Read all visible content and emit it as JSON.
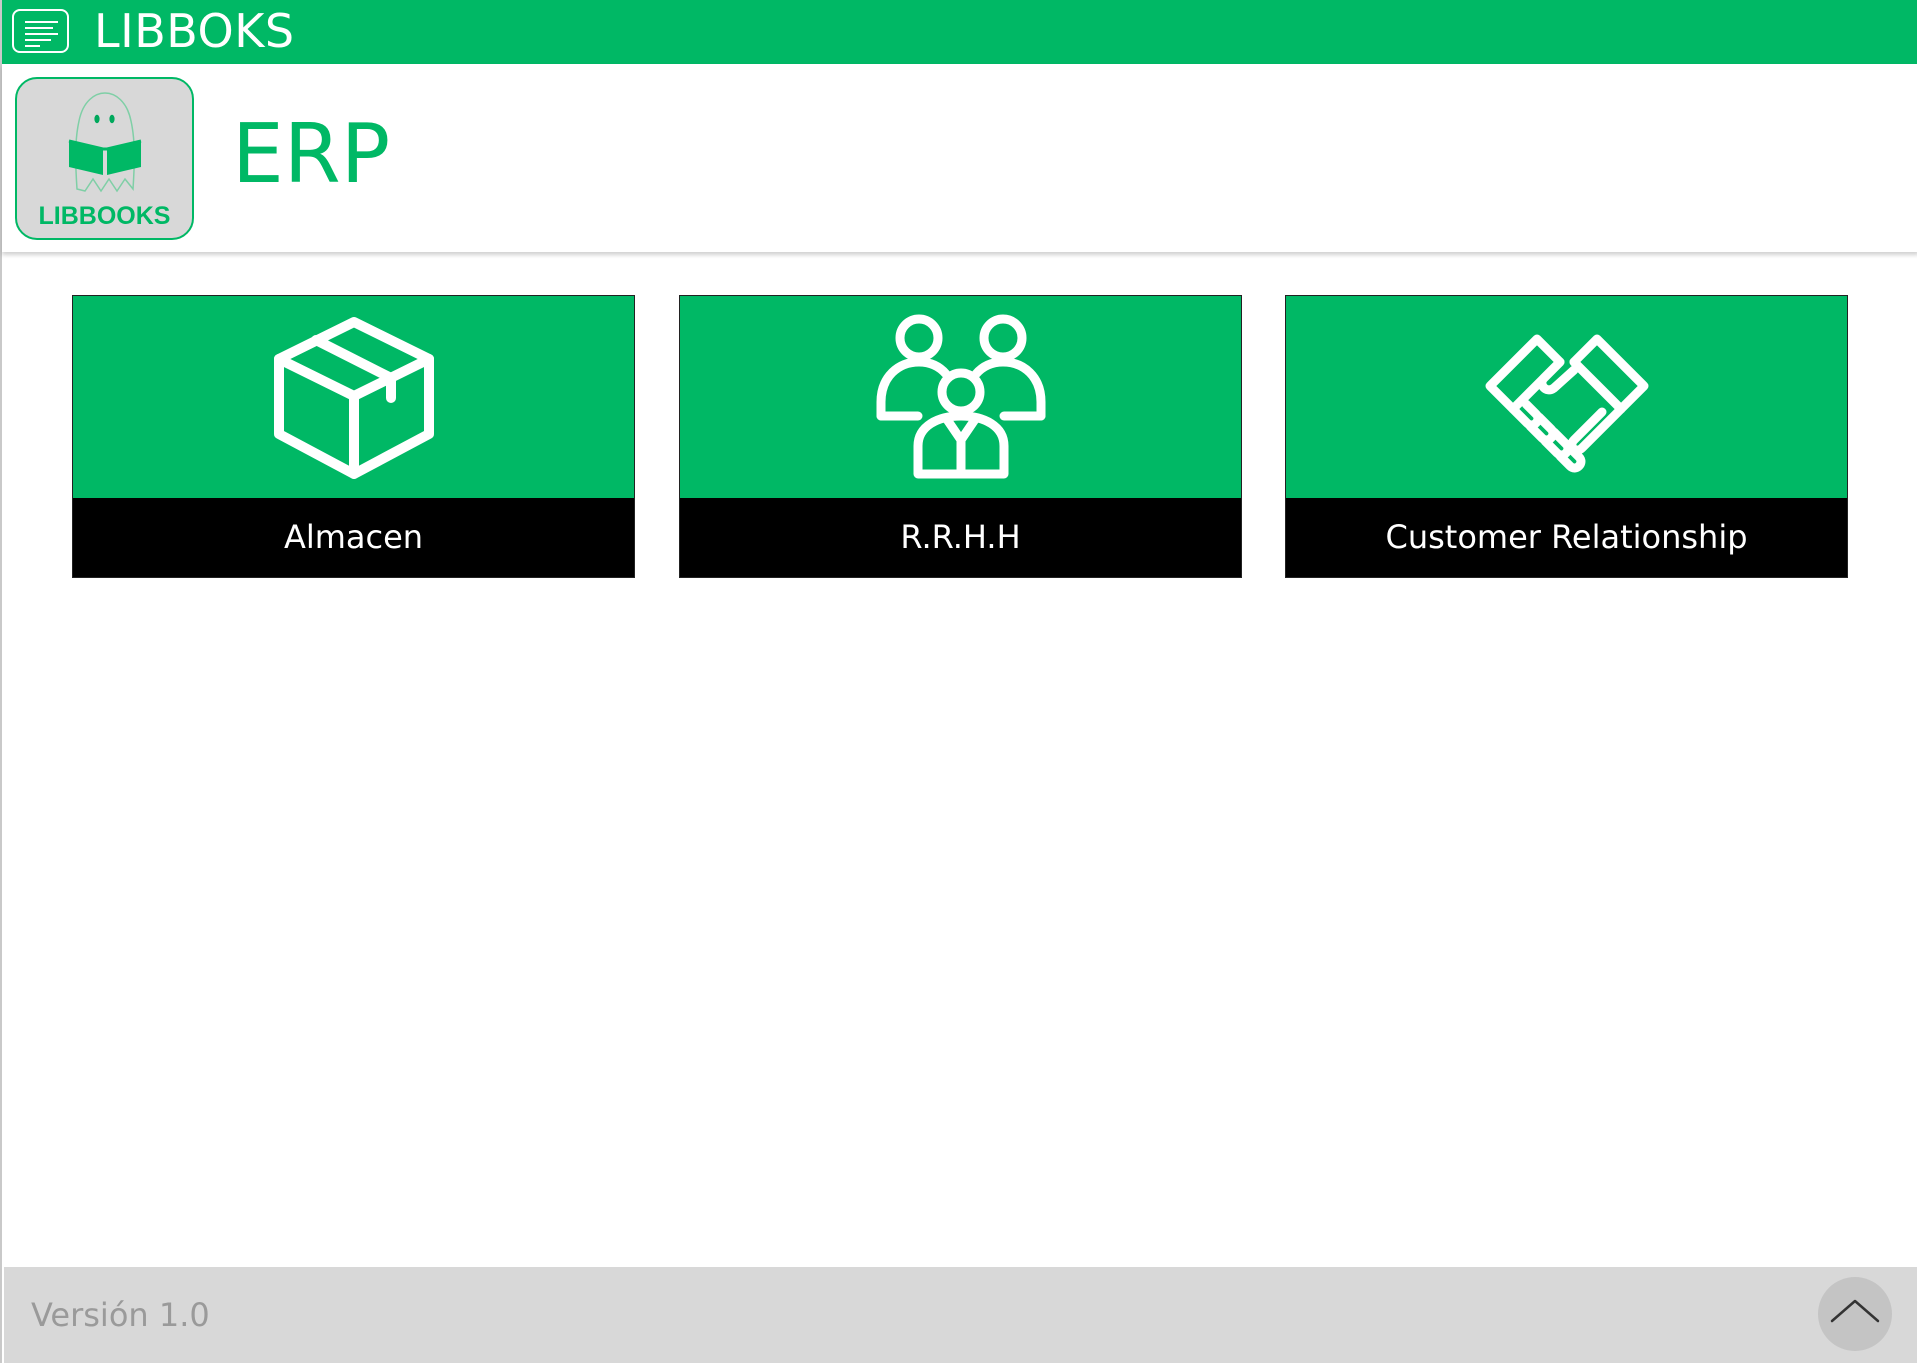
{
  "topbar": {
    "menu_icon": "menu-icon",
    "app_title": "LIBBOKS"
  },
  "header": {
    "logo_text": "LIBBOOKS",
    "page_title": "ERP"
  },
  "modules": [
    {
      "label": "Almacen",
      "icon": "box-icon"
    },
    {
      "label": "R.R.H.H",
      "icon": "people-icon"
    },
    {
      "label": "Customer Relationship",
      "icon": "handshake-icon"
    }
  ],
  "footer": {
    "version": "Versión 1.0",
    "scroll_top_icon": "chevron-up-icon"
  },
  "colors": {
    "brand_green": "#00b865",
    "caption_bg": "#000000",
    "footer_bg": "#d8d8d8"
  }
}
